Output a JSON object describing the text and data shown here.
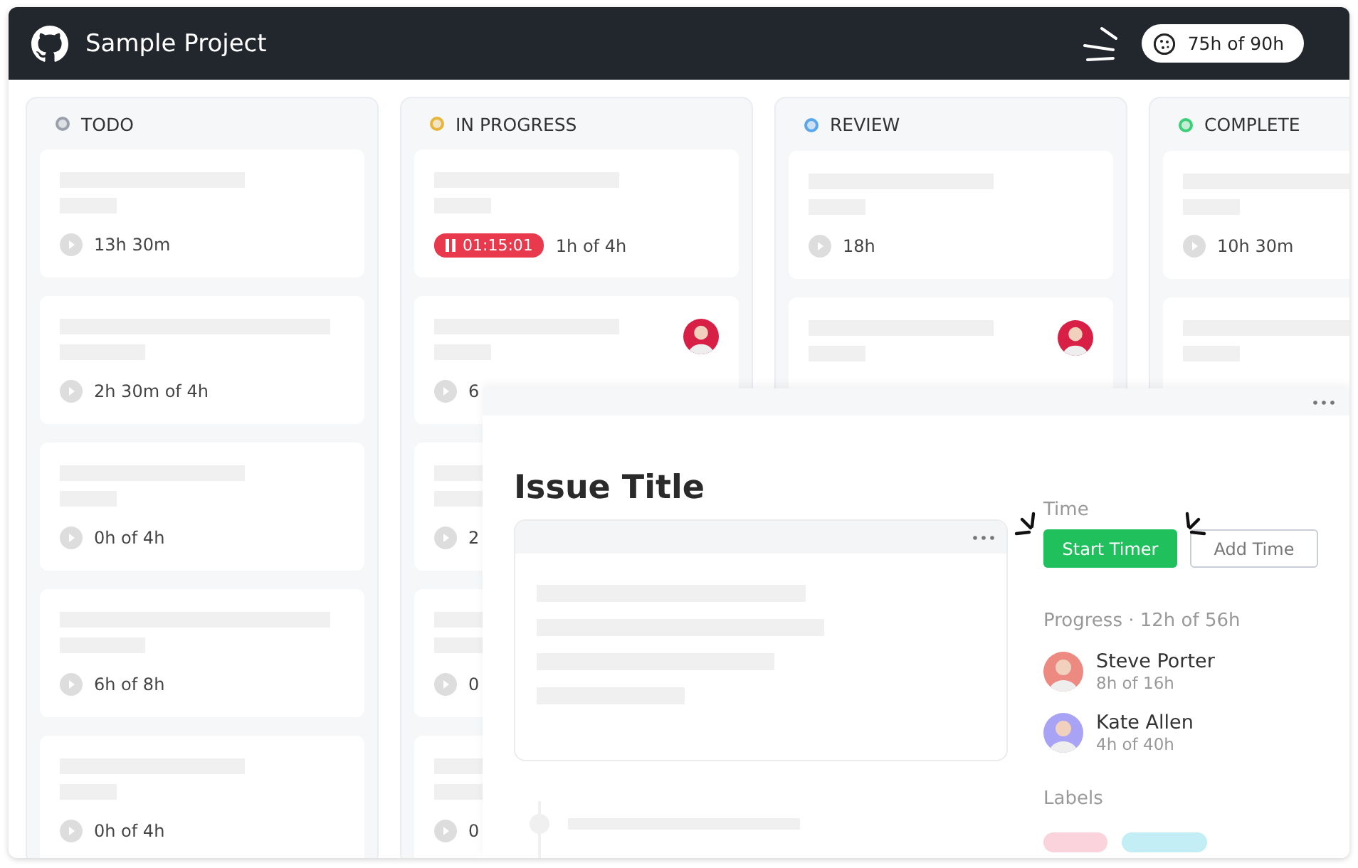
{
  "header": {
    "title": "Sample Project",
    "budget": "75h of 90h"
  },
  "columns": [
    {
      "name": "TODO",
      "color": "#9aa1ab",
      "cards": [
        {
          "kind": "task",
          "time": "13h 30m"
        },
        {
          "kind": "task",
          "time": "2h 30m of 4h"
        },
        {
          "kind": "task",
          "time": "0h of 4h"
        },
        {
          "kind": "task",
          "time": "6h of 8h"
        },
        {
          "kind": "task",
          "time": "0h of 4h"
        }
      ]
    },
    {
      "name": "IN PROGRESS",
      "color": "#e7b53c",
      "cards": [
        {
          "kind": "task",
          "timer": "01:15:01",
          "time": "1h of 4h"
        },
        {
          "kind": "task",
          "avatar": {
            "color": "#d81f45"
          },
          "time": "6"
        },
        {
          "kind": "task",
          "time": "2"
        },
        {
          "kind": "task",
          "time": "0"
        },
        {
          "kind": "task",
          "time": "0"
        }
      ]
    },
    {
      "name": "REVIEW",
      "color": "#59a7e8",
      "cards": [
        {
          "kind": "task",
          "time": "18h"
        },
        {
          "kind": "task",
          "avatar": {
            "color": "#d81f45"
          }
        }
      ]
    },
    {
      "name": "COMPLETE",
      "color": "#3ccf78",
      "cards": [
        {
          "kind": "task",
          "time": "10h 30m"
        },
        {
          "kind": "task"
        }
      ]
    }
  ],
  "issue": {
    "title": "Issue Title",
    "time_label": "Time",
    "start_button": "Start Timer",
    "add_button": "Add Time",
    "progress": "Progress · 12h of 56h",
    "people": [
      {
        "name": "Steve Porter",
        "time": "8h of 16h",
        "color": "#ec8a82"
      },
      {
        "name": "Kate Allen",
        "time": "4h of 40h",
        "color": "#a9a3f5"
      }
    ],
    "labels_heading": "Labels",
    "labels": [
      {
        "color": "#fbd3dd"
      },
      {
        "color": "#c4eef5"
      }
    ]
  }
}
